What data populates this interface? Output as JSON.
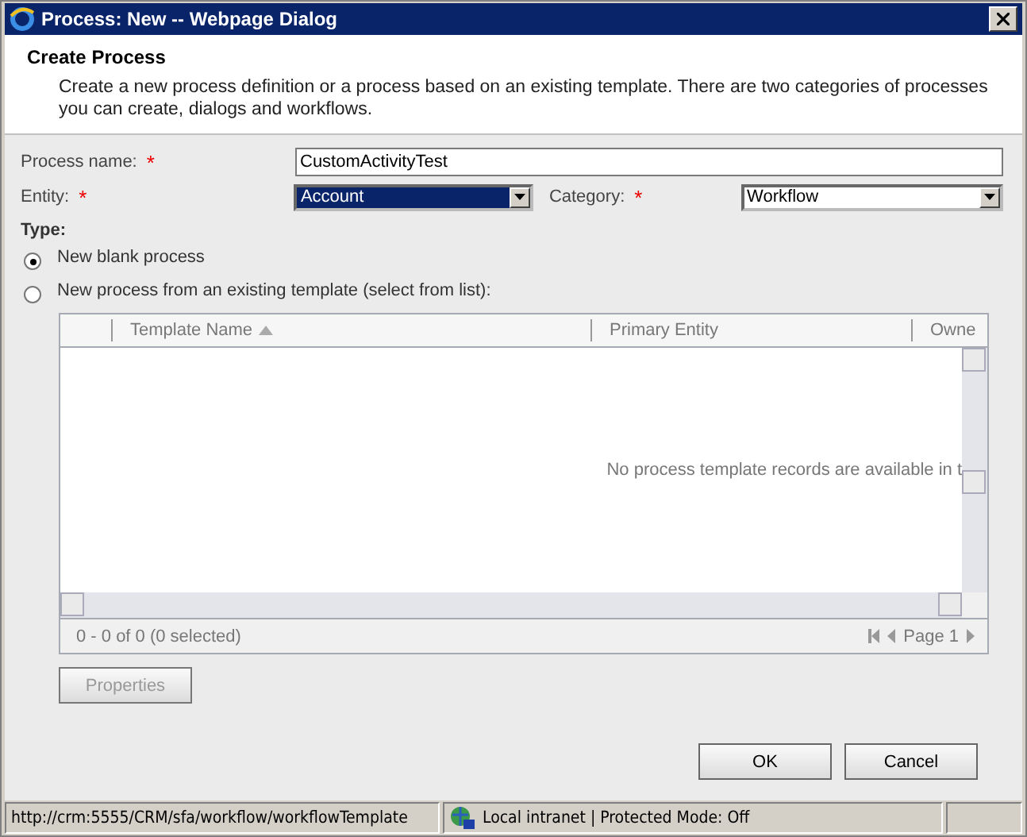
{
  "window": {
    "title": "Process: New -- Webpage Dialog"
  },
  "header": {
    "title": "Create Process",
    "description": "Create a new process definition or a process based on an existing template. There are two categories of processes you can create, dialogs and workflows."
  },
  "process_name": {
    "label": "Process name:",
    "required_mark": "*",
    "value": "CustomActivityTest"
  },
  "entity": {
    "label": "Entity:",
    "required_mark": "*",
    "value": "Account",
    "focused": true
  },
  "category": {
    "label": "Category:",
    "required_mark": "*",
    "value": "Workflow",
    "focused": false
  },
  "type": {
    "label": "Type:",
    "options": [
      {
        "label": "New blank process",
        "selected": true
      },
      {
        "label": "New process from an existing template (select from list):",
        "selected": false
      }
    ]
  },
  "grid": {
    "columns": [
      {
        "label": "Template Name",
        "sorted": true
      },
      {
        "label": "Primary Entity",
        "sorted": false
      },
      {
        "label": "Owne",
        "sorted": false
      }
    ],
    "empty_message": "No process template records are available in t",
    "record_count": "0 - 0 of 0 (0 selected)",
    "page": "Page 1"
  },
  "properties_button": {
    "label": "Properties",
    "disabled": true
  },
  "buttons": [
    "OK",
    "Cancel"
  ],
  "status_bar": {
    "url": "http://crm:5555/CRM/sfa/workflow/workflowTemplate",
    "zone": "Local intranet | Protected Mode: Off"
  }
}
